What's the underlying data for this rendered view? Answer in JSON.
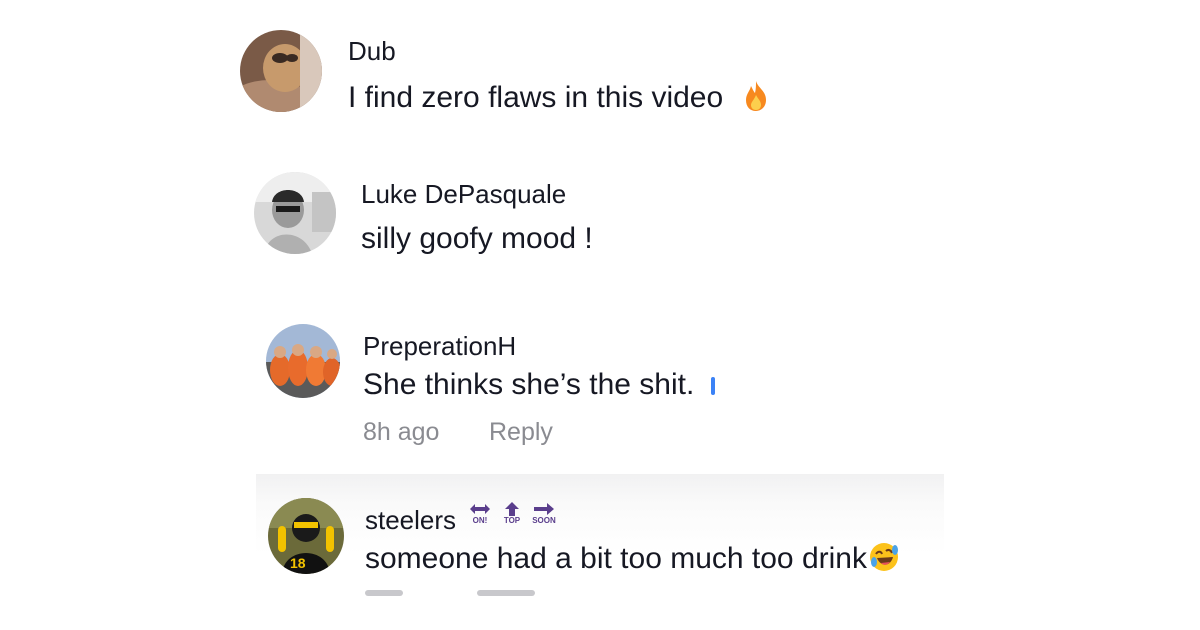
{
  "comments": [
    {
      "username": "Dub",
      "text": "I find zero flaws in this video",
      "emoji": "fire-emoji"
    },
    {
      "username": "Luke DePasquale",
      "text": "silly goofy mood !"
    },
    {
      "username": "PreperationH",
      "text": "She thinks she’s the shit.",
      "time": "8h ago",
      "reply_label": "Reply"
    },
    {
      "username": "steelers",
      "badges": [
        "ON!",
        "TOP",
        "SOON"
      ],
      "text": "someone had a bit too much too drink",
      "emoji": "rolling-laughing-emoji"
    }
  ],
  "colors": {
    "text": "#161823",
    "meta": "#8a8b91",
    "badge": "#5a3e8c",
    "fire": "#f7891f"
  }
}
